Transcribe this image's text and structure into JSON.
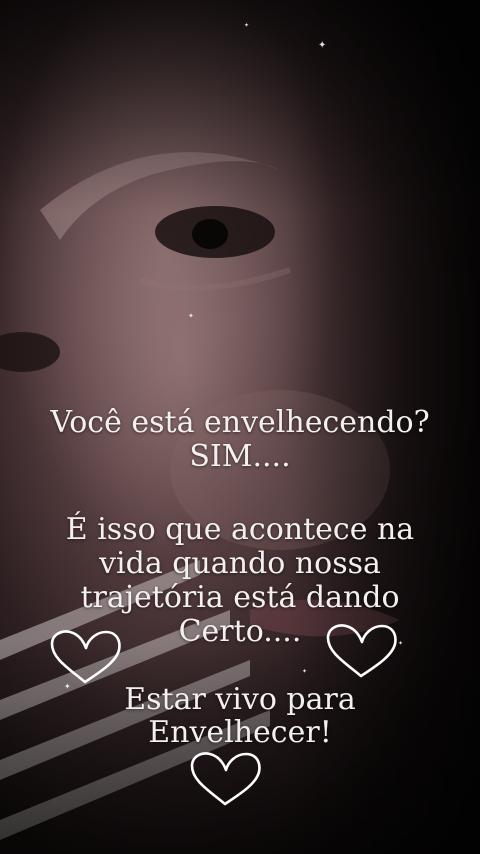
{
  "text": {
    "question": "Você está envelhecendo?",
    "answer": "SIM....",
    "paragraph_line1": "É isso que acontece na",
    "paragraph_line2": "vida quando nossa",
    "paragraph_line3": "trajetória está dando",
    "paragraph_line4": "Certo....",
    "closing_line1": "Estar vivo para",
    "closing_line2": "Envelhecer!"
  },
  "icons": [
    "heart-outline-icon",
    "heart-outline-icon",
    "heart-outline-icon",
    "sparkle-icon"
  ],
  "colors": {
    "text": "#f4f0f0",
    "heart_stroke": "#ffffff",
    "background": "#1a1210"
  }
}
